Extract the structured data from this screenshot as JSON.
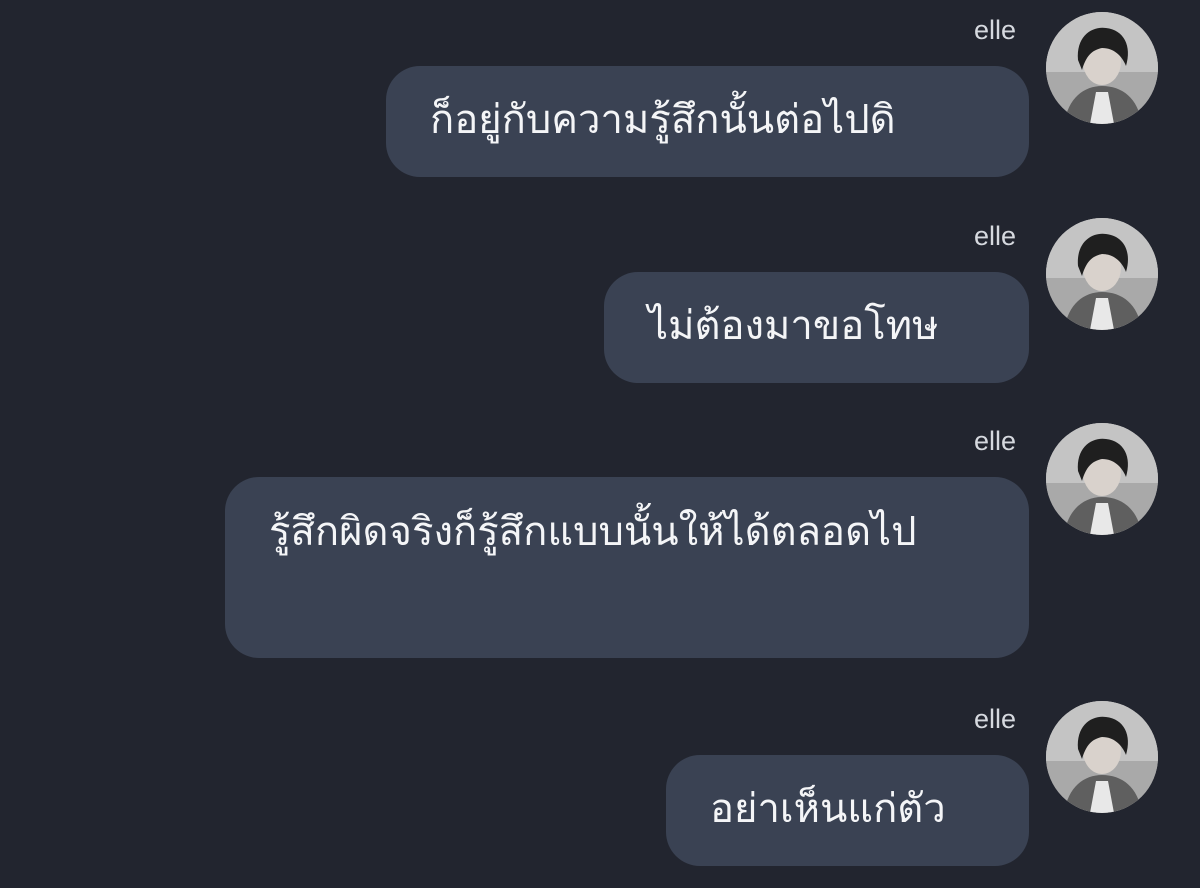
{
  "messages": [
    {
      "sender": "elle",
      "text": "ก็อยู่กับความรู้สึกนั้นต่อไปดิ",
      "avatar_icon": "user-avatar-icon"
    },
    {
      "sender": "elle",
      "text": "ไม่ต้องมาขอโทษ",
      "avatar_icon": "user-avatar-icon"
    },
    {
      "sender": "elle",
      "text": "รู้สึกผิดจริงก็รู้สึกแบบนั้นให้ได้ตลอดไป",
      "avatar_icon": "user-avatar-icon"
    },
    {
      "sender": "elle",
      "text": "อย่าเห็นแก่ตัว",
      "avatar_icon": "user-avatar-icon"
    }
  ],
  "colors": {
    "background": "#22252f",
    "bubble": "#3a4253",
    "bubble_text": "#f4f5f7",
    "sender_text": "#d6d9df"
  }
}
